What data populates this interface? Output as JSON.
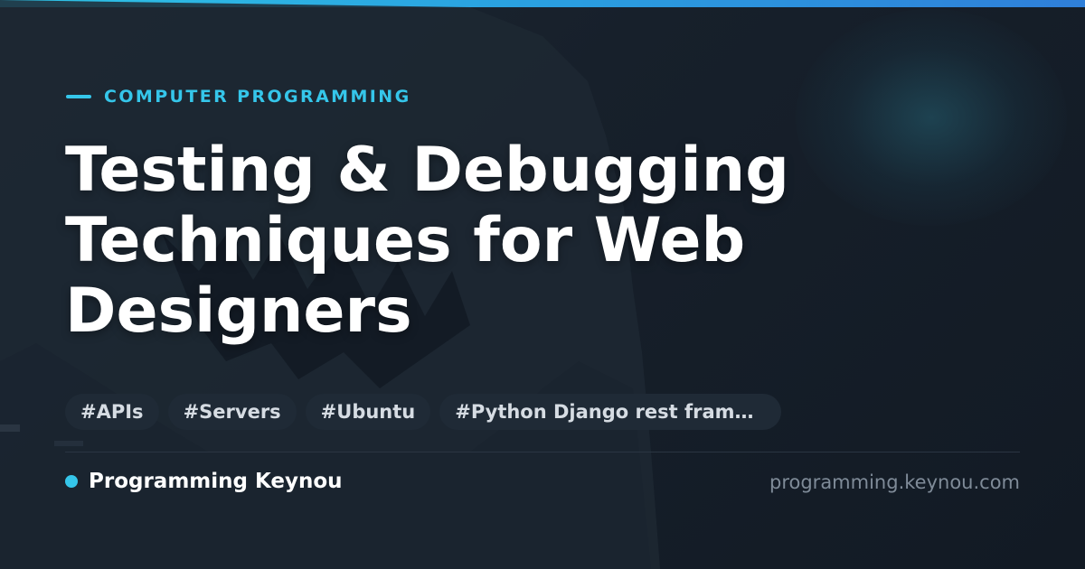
{
  "header": {
    "category": "COMPUTER PROGRAMMING"
  },
  "article": {
    "title": "Testing & Debugging Techniques for Web Designers"
  },
  "tags": [
    "#APIs",
    "#Servers",
    "#Ubuntu",
    "#Python Django rest frame..."
  ],
  "footer": {
    "brand_name": "Programming Keynou",
    "domain": "programming.keynou.com"
  },
  "colors": {
    "accent": "#35c6ea",
    "background": "#17202b",
    "tag_background": "#1f2a36",
    "title": "#ffffff",
    "domain_text": "#7f8b98"
  },
  "icons": {
    "brand": "brand-dot-icon"
  }
}
